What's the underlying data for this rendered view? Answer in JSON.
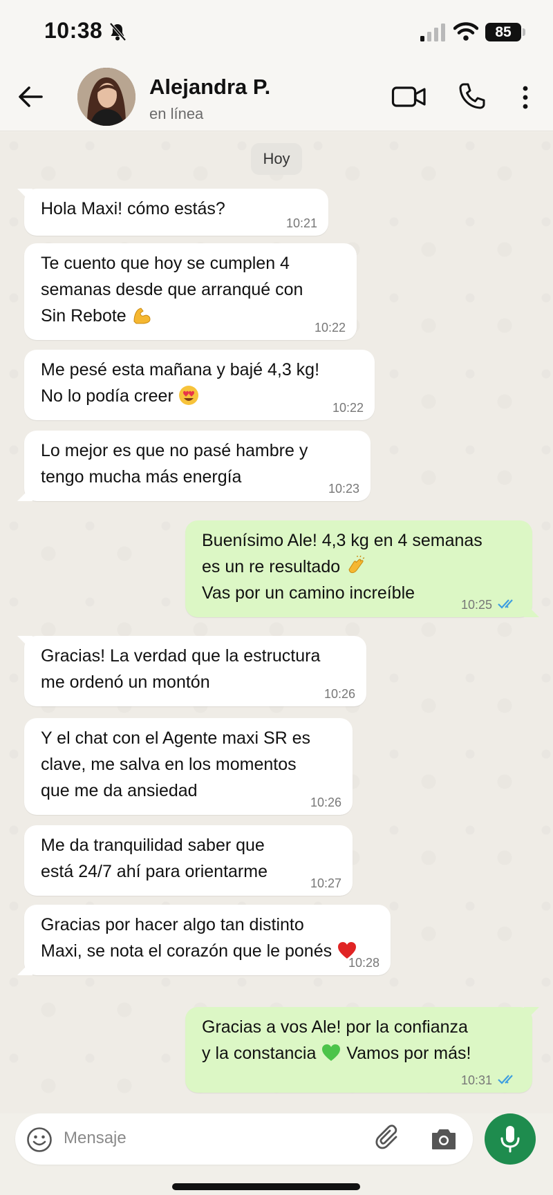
{
  "status_bar": {
    "time": "10:38",
    "battery": "85"
  },
  "header": {
    "contact_name": "Alejandra P.",
    "contact_status": "en línea"
  },
  "chat": {
    "date_label": "Hoy",
    "messages": [
      {
        "direction": "in",
        "text": "Hola Maxi! cómo estás?",
        "time": "10:21"
      },
      {
        "direction": "in",
        "text": "Te cuento que hoy se cumplen 4\nsemanas desde que arranqué con\nSin Rebote",
        "emoji": "flexed-biceps",
        "time": "10:22"
      },
      {
        "direction": "in",
        "text": "Me pesé esta mañana y bajé 4,3 kg!\nNo lo podía creer",
        "emoji": "heart-eyes",
        "time": "10:22"
      },
      {
        "direction": "in",
        "text": "Lo mejor es que no pasé hambre y\ntengo mucha más energía",
        "time": "10:23"
      },
      {
        "direction": "out",
        "text": "Buenísimo Ale! 4,3 kg en 4 semanas\nes un re resultado",
        "emoji": "clapping-hands",
        "text2": "Vas por un camino increíble",
        "time": "10:25",
        "status": "read"
      },
      {
        "direction": "in",
        "text": "Gracias! La verdad que la estructura\nme ordenó un montón",
        "time": "10:26"
      },
      {
        "direction": "in",
        "text": "Y el chat con el Agente maxi SR es\nclave, me salva en los momentos\nque me da ansiedad",
        "time": "10:26"
      },
      {
        "direction": "in",
        "text": "Me da tranquilidad saber que\nestá 24/7 ahí para orientarme",
        "time": "10:27"
      },
      {
        "direction": "in",
        "text": "Gracias por hacer algo tan distinto\nMaxi, se nota el corazón que le ponés",
        "emoji": "red-heart",
        "time": "10:28"
      },
      {
        "direction": "out",
        "text": "Gracias a vos Ale! por la confianza\ny la constancia",
        "emoji": "green-heart",
        "text2": "Vamos por más!",
        "time": "10:31",
        "status": "read"
      }
    ]
  },
  "input": {
    "placeholder": "Mensaje"
  },
  "colors": {
    "incoming_bubble": "#ffffff",
    "outgoing_bubble": "#dcf7c5",
    "read_ticks": "#3e9ee0",
    "mic_button": "#1e8c4e"
  }
}
